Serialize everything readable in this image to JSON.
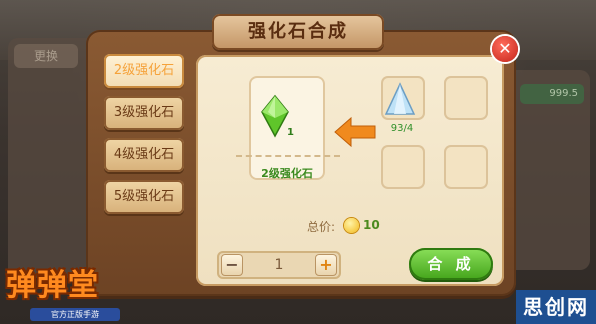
{
  "background": {
    "left_tag": "更换",
    "right_tag": "999.5"
  },
  "dialog": {
    "title": "强化石合成",
    "close_label": "✕"
  },
  "tabs": [
    {
      "label": "2级强化石",
      "active": true
    },
    {
      "label": "3级强化石",
      "active": false
    },
    {
      "label": "4级强化石",
      "active": false
    },
    {
      "label": "5级强化石",
      "active": false
    }
  ],
  "result": {
    "name": "2级强化石",
    "count": "1",
    "gem_color": "#5fc52a",
    "icon": "green-gem-icon"
  },
  "materials": [
    {
      "icon": "blue-gem-icon",
      "count": "93/4",
      "gem_color": "#9cc9e8"
    },
    {
      "icon": "empty-slot"
    },
    {
      "icon": "empty-slot"
    },
    {
      "icon": "empty-slot"
    }
  ],
  "price": {
    "label": "总价:",
    "value": "10",
    "icon": "gold-coin-icon"
  },
  "stepper": {
    "minus": "−",
    "plus": "+",
    "value": "1"
  },
  "compose_button": "合 成",
  "logo": {
    "text": "弹弹堂",
    "subtitle": "官方正版手游"
  },
  "watermark": "思创网",
  "colors": {
    "accent_orange": "#f5a23a",
    "green_button": "#43a31a",
    "dialog_brown": "#8a5a33"
  }
}
